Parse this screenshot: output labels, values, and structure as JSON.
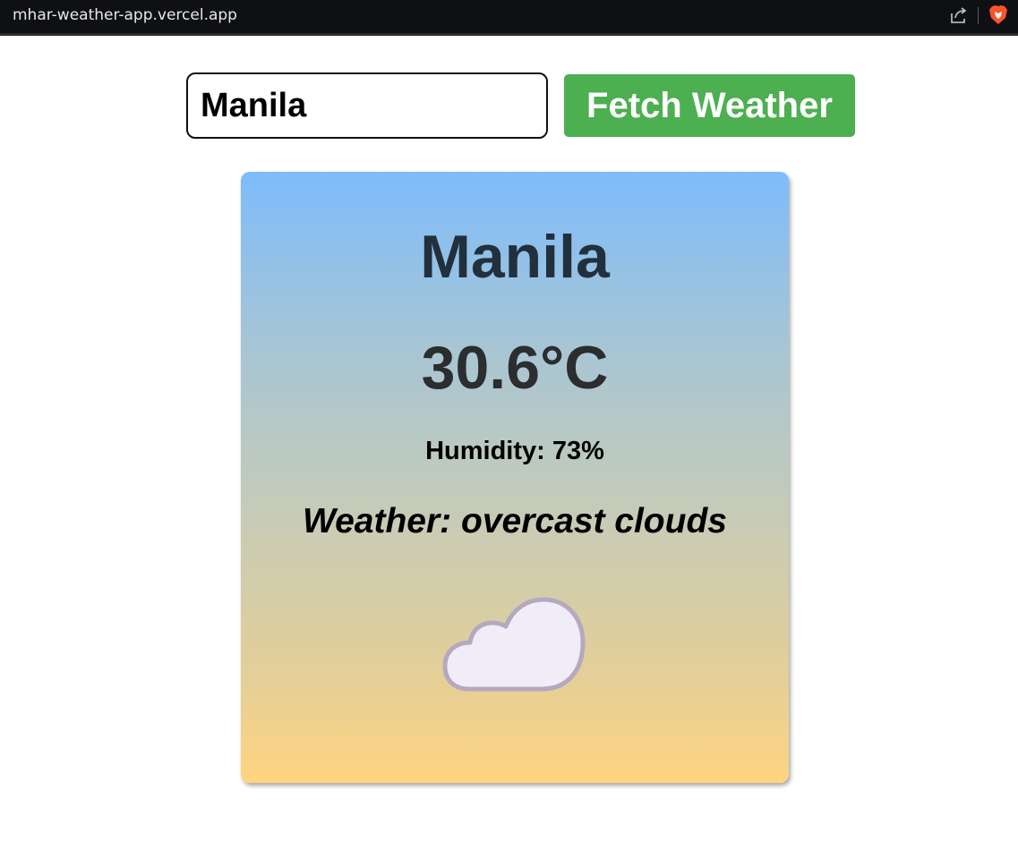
{
  "browser": {
    "url": "mhar-weather-app.vercel.app",
    "icons": [
      "share-icon",
      "brave-icon"
    ]
  },
  "search": {
    "value": "Manila",
    "button_label": "Fetch Weather"
  },
  "weather_card": {
    "city": "Manila",
    "temperature": "30.6°C",
    "humidity": "Humidity: 73%",
    "description": "Weather: overcast clouds",
    "icon": "cloud-icon"
  },
  "colors": {
    "button": "#4caf50",
    "gradient_top": "#7dbcfc",
    "gradient_bottom": "#ffd480",
    "cloud_fill": "#f1edf8",
    "cloud_stroke": "#b4a9c0"
  }
}
